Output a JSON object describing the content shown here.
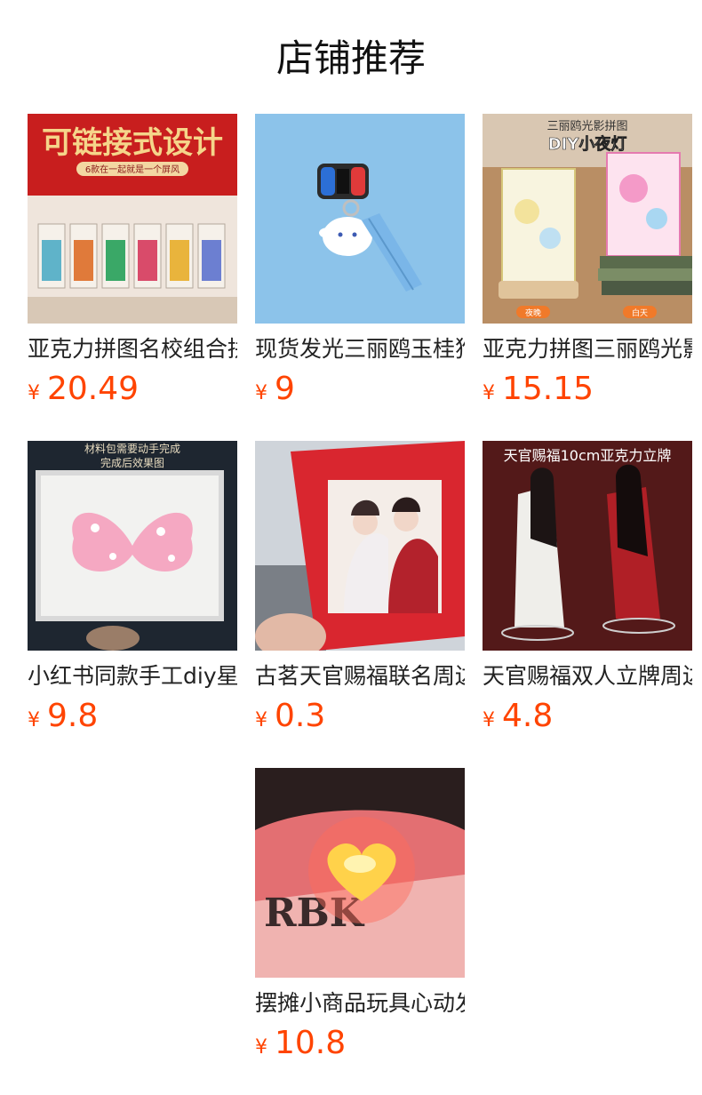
{
  "page": {
    "title": "店铺推荐",
    "currency_symbol": "¥",
    "price_color": "#ff4400"
  },
  "products": [
    {
      "name": "亚克力拼图名校组合拼",
      "price": "20.49",
      "image": {
        "theme": "university-puzzle",
        "banner_text": "可链接式设计",
        "sub_text": "6款在一起就是一个屏风"
      }
    },
    {
      "name": "现货发光三丽鸥玉桂狗",
      "price": "9",
      "image": {
        "theme": "glowing-keychain"
      }
    },
    {
      "name": "亚克力拼图三丽鸥光影",
      "price": "15.15",
      "image": {
        "theme": "night-light-puzzle",
        "top_text": "三丽鸥光影拼图",
        "headline": "DIY小夜灯",
        "label_left": "夜晚",
        "label_right": "白天"
      }
    },
    {
      "name": "小红书同款手工diy星星",
      "price": "9.8",
      "image": {
        "theme": "butterfly-frame",
        "line1": "材料包需要动手完成",
        "line2": "完成后效果图"
      }
    },
    {
      "name": "古茗天官赐福联名周边",
      "price": "0.3",
      "image": {
        "theme": "photo-card"
      }
    },
    {
      "name": "天官赐福双人立牌周边",
      "price": "4.8",
      "image": {
        "theme": "acrylic-stand",
        "headline": "天官赐福10cm亚克力立牌"
      }
    },
    {
      "name": "摆摊小商品玩具心动发光",
      "price": "10.8",
      "image": {
        "theme": "heart-light"
      }
    }
  ]
}
